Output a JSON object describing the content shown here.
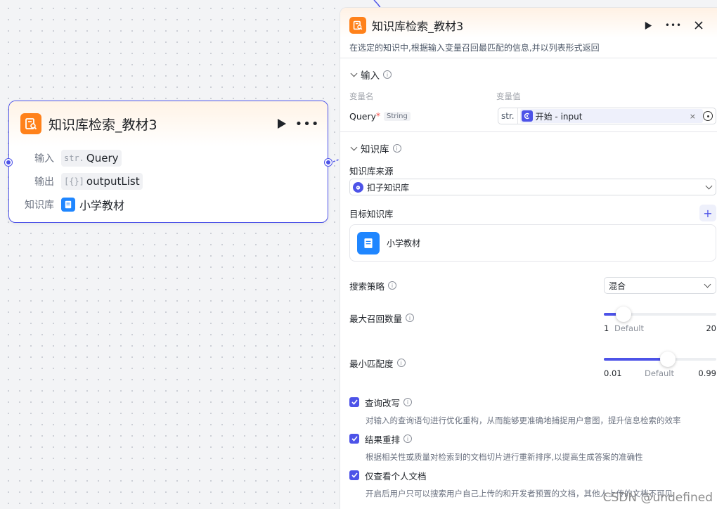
{
  "node": {
    "title": "知识库检索_教材3",
    "rows": {
      "input_label": "输入",
      "input_prefix": "str.",
      "input_value": "Query",
      "output_label": "输出",
      "output_prefix": "[{}]",
      "output_value": "outputList",
      "kb_label": "知识库",
      "kb_value": "小学教材"
    }
  },
  "panel": {
    "title": "知识库检索_教材3",
    "description": "在选定的知识中,根据输入变量召回最匹配的信息,并以列表形式返回",
    "input_section": {
      "title": "输入",
      "col_name": "变量名",
      "col_value": "变量值",
      "var_name": "Query",
      "required_mark": "*",
      "var_type": "String",
      "value_prefix": "str.",
      "value_ref": "开始 - input"
    },
    "kb_section": {
      "title": "知识库",
      "source_label": "知识库来源",
      "source_value": "扣子知识库",
      "target_label": "目标知识库",
      "target_item": "小学教材",
      "strategy_label": "搜索策略",
      "strategy_value": "混合",
      "max_recall": {
        "label": "最大召回数量",
        "min": "1",
        "max": "20",
        "default_label": "Default",
        "value": 3,
        "range": [
          1,
          20
        ]
      },
      "min_match": {
        "label": "最小匹配度",
        "min": "0.01",
        "max": "0.99",
        "default_label": "Default",
        "value": 0.5,
        "range": [
          0.01,
          0.99
        ]
      },
      "options": [
        {
          "label": "查询改写",
          "checked": true,
          "desc": "对输入的查询语句进行优化重构，从而能够更准确地捕捉用户意图，提升信息检索的效率"
        },
        {
          "label": "结果重排",
          "checked": true,
          "desc": "根据相关性或质量对检索到的文档切片进行重新排序,以提高生成答案的准确性"
        },
        {
          "label": "仅查看个人文档",
          "checked": true,
          "desc": "开启后用户只可以搜索用户自己上传的和开发者预置的文档，其他人上传的文档不可见"
        }
      ]
    }
  },
  "watermark": "CSDN @undefined",
  "colors": {
    "accent": "#4d53e8",
    "node_logo": "#ff811a",
    "kb_icon": "#1f86ff"
  }
}
